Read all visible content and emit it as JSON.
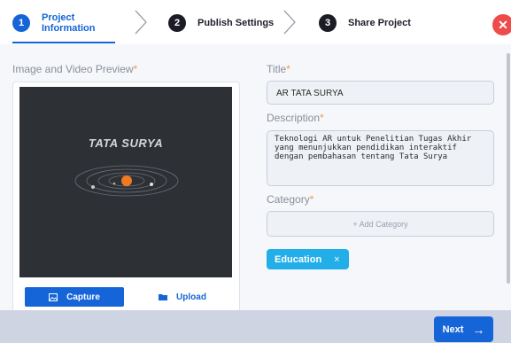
{
  "stepper": {
    "steps": [
      {
        "number": "1",
        "label": "Project\nInformation",
        "active": true
      },
      {
        "number": "2",
        "label": "Publish Settings",
        "active": false
      },
      {
        "number": "3",
        "label": "Share Project",
        "active": false
      }
    ],
    "close_icon": "close-icon"
  },
  "preview": {
    "label": "Image and Video Preview",
    "required": "*",
    "image_title": "TATA SURYA",
    "capture_label": "Capture",
    "upload_label": "Upload"
  },
  "form": {
    "title_label": "Title",
    "title_value": "AR TATA SURYA",
    "description_label": "Description",
    "description_value": "Teknologi AR untuk Penelitian Tugas Akhir\nyang menunjukkan pendidikan interaktif\ndengan pembahasan tentang Tata Surya",
    "category_label": "Category",
    "add_category_label": "+ Add Category",
    "tags": [
      {
        "label": "Education",
        "remove": "×"
      }
    ]
  },
  "footer": {
    "next_label": "Next",
    "next_arrow": "→"
  },
  "colors": {
    "accent": "#1565d8",
    "tag": "#22aee8",
    "close": "#ef4b4b",
    "required": "#e3a14a"
  }
}
